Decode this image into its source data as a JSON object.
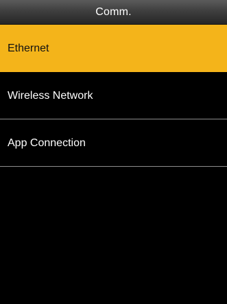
{
  "header": {
    "title": "Comm."
  },
  "menu": {
    "items": [
      {
        "label": "Ethernet",
        "selected": true
      },
      {
        "label": "Wireless Network",
        "selected": false
      },
      {
        "label": "App Connection",
        "selected": false
      }
    ]
  },
  "colors": {
    "selected_background": "#f4b41a",
    "screen_background": "#000000",
    "title_bar": "#3f3f3f",
    "divider": "#8e8e8e",
    "text": "#ffffff"
  }
}
